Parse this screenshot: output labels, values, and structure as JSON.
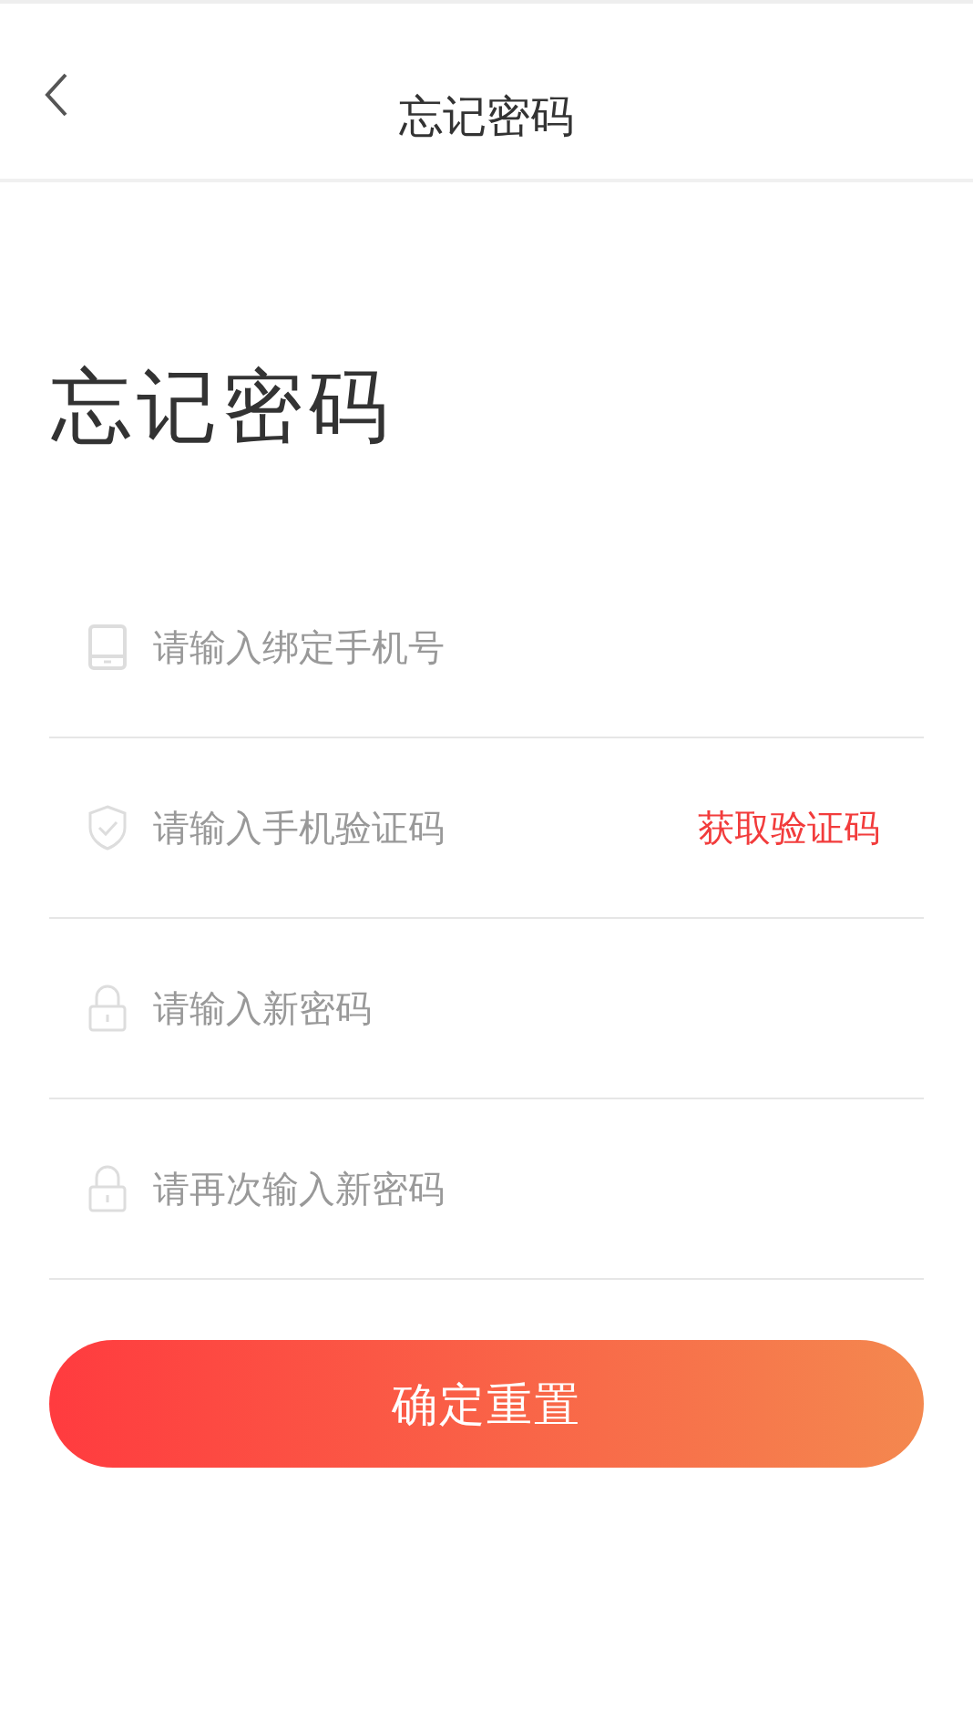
{
  "header": {
    "title": "忘记密码"
  },
  "heading": "忘记密码",
  "fields": [
    {
      "kind": "phone",
      "placeholder": "请输入绑定手机号"
    },
    {
      "kind": "shield",
      "placeholder": "请输入手机验证码",
      "action": "获取验证码"
    },
    {
      "kind": "lock",
      "placeholder": "请输入新密码"
    },
    {
      "kind": "lock",
      "placeholder": "请再次输入新密码"
    }
  ],
  "submit": "确定重置"
}
